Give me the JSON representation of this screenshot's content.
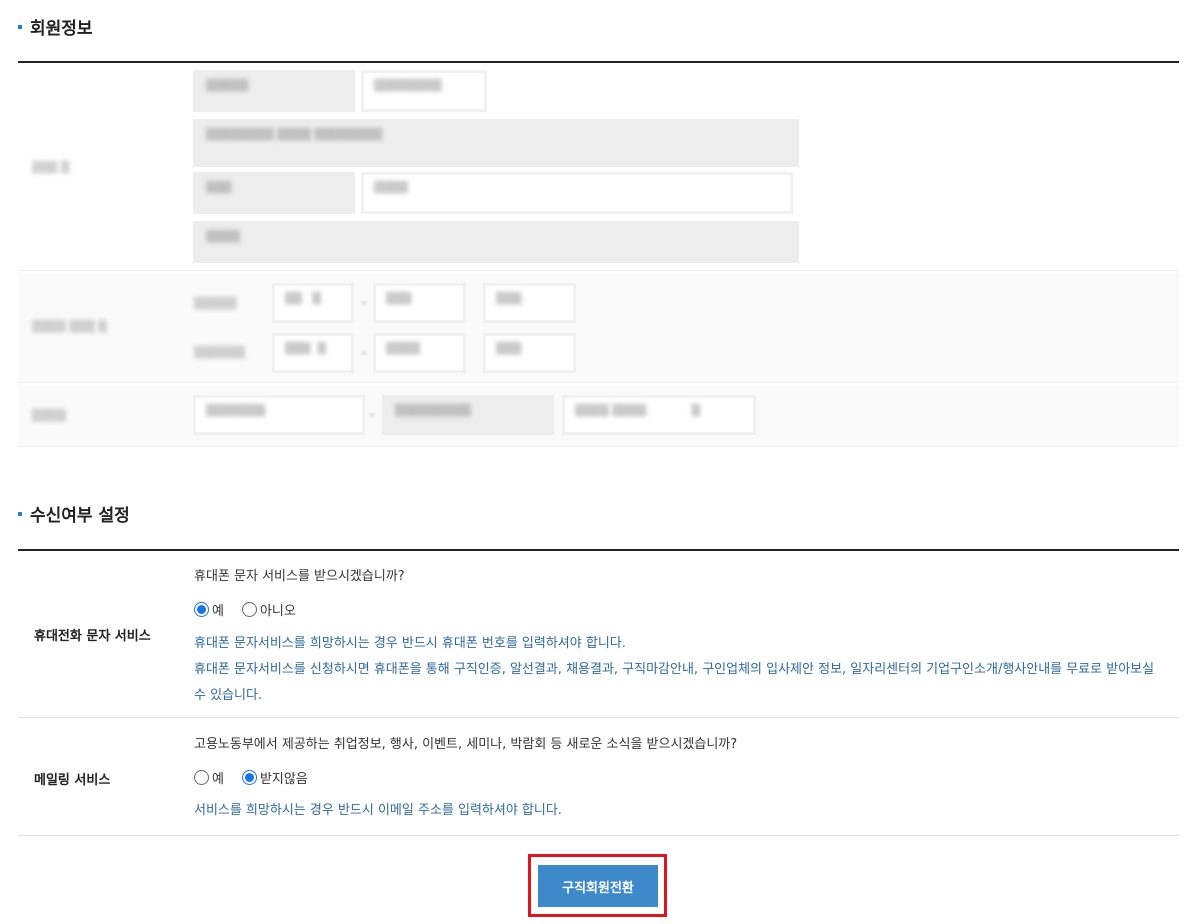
{
  "sections": {
    "member_info_title": "회원정보",
    "receive_title": "수신여부 설정"
  },
  "sms": {
    "label": "휴대전화 문자 서비스",
    "question": "휴대폰 문자 서비스를 받으시겠습니까?",
    "options": [
      "예",
      "아니오"
    ],
    "selected": "예",
    "note_line1": "휴대폰 문자서비스를 희망하시는 경우 반드시 휴대폰 번호를 입력하셔야 합니다.",
    "note_line2": "휴대폰 문자서비스를 신청하시면 휴대폰을 통해 구직인증, 알선결과, 채용결과, 구직마감안내, 구인업체의 입사제안 정보, 일자리센터의 기업구인소개/행사안내를 무료로 받아보실 수 있습니다."
  },
  "mailing": {
    "label": "메일링 서비스",
    "question": "고용노동부에서 제공하는 취업정보, 행사, 이벤트, 세미나, 박람회 등 새로운 소식을 받으시겠습니까?",
    "options": [
      "예",
      "받지않음"
    ],
    "selected": "받지않음",
    "note": "서비스를 희망하시는 경우 반드시 이메일 주소를 입력하셔야 합니다."
  },
  "submit_label": "구직회원전환",
  "colors": {
    "accent": "#2b7fc4",
    "button": "#3d89c9",
    "note_text": "#2f6a9e",
    "highlight": "#e0141e"
  }
}
